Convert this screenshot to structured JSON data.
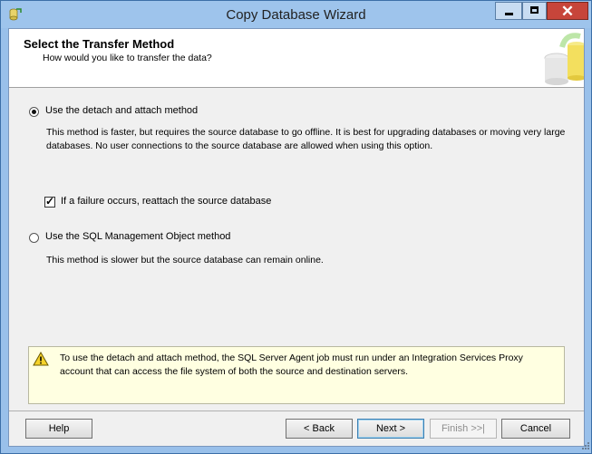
{
  "window": {
    "title": "Copy Database Wizard"
  },
  "header": {
    "title": "Select the Transfer Method",
    "subtitle": "How would you like to transfer the data?"
  },
  "options": [
    {
      "label": "Use the detach and attach method",
      "selected": true,
      "description": "This method is faster, but requires the source database to go offline. It is best for upgrading databases or moving very large databases. No user connections to the source database are allowed when using this option."
    },
    {
      "label": "Use the SQL Management Object method",
      "selected": false,
      "description": "This method is slower but the source database can remain online."
    }
  ],
  "reattach_checkbox": {
    "label": "If a failure occurs, reattach the source database",
    "checked": true
  },
  "notice": {
    "icon": "warning-icon",
    "text": "To use the detach and attach method, the SQL Server Agent job must run under an Integration Services Proxy account that can access the file system of both the source and destination servers."
  },
  "buttons": {
    "help": "Help",
    "back": "< Back",
    "next": "Next >",
    "finish": "Finish >>|",
    "cancel": "Cancel"
  },
  "colors": {
    "titlebar": "#9ec4ec",
    "close_button": "#c7453a",
    "notice_background": "#ffffe1",
    "dialog_background": "#f0f0f0"
  }
}
